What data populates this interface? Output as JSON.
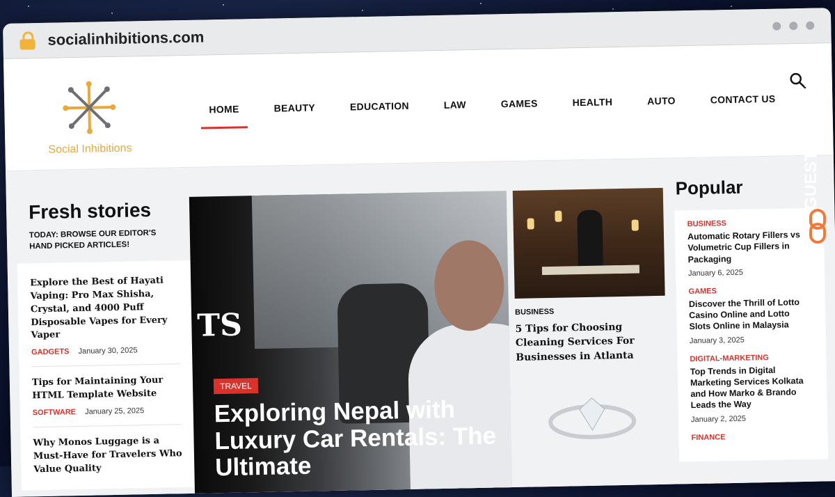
{
  "browser": {
    "url": "socialinhibitions.com"
  },
  "logo": {
    "text": "Social Inhibitions"
  },
  "nav": [
    "HOME",
    "BEAUTY",
    "EDUCATION",
    "LAW",
    "GAMES",
    "HEALTH",
    "AUTO",
    "CONTACT US"
  ],
  "fresh": {
    "title": "Fresh stories",
    "subtitle": "TODAY: BROWSE OUR EDITOR'S HAND PICKED ARTICLES!",
    "stories": [
      {
        "title": "Explore the Best of Hayati Vaping: Pro Max Shisha, Crystal, and 4000 Puff Disposable Vapes for Every Vaper",
        "category": "GADGETS",
        "date": "January 30, 2025"
      },
      {
        "title": "Tips for Maintaining Your HTML Template Website",
        "category": "SOFTWARE",
        "date": "January 25, 2025"
      },
      {
        "title": "Why Monos Luggage is a Must-Have for Travelers Who Value Quality",
        "category": "",
        "date": ""
      }
    ]
  },
  "hero": {
    "overlay_text": "TS",
    "category": "TRAVEL",
    "title": "Exploring Nepal with Luxury Car Rentals: The Ultimate"
  },
  "mid": {
    "category": "BUSINESS",
    "title": "5 Tips for Choosing Cleaning Services For Businesses in Atlanta"
  },
  "popular": {
    "title": "Popular",
    "items": [
      {
        "category": "BUSINESS",
        "title": "Automatic Rotary Fillers vs Volumetric Cup Fillers in Packaging",
        "date": "January 6, 2025"
      },
      {
        "category": "GAMES",
        "title": "Discover the Thrill of Lotto Casino Online and Lotto Slots Online in Malaysia",
        "date": "January 3, 2025"
      },
      {
        "category": "DIGITAL-MARKETING",
        "title": "Top Trends in Digital Marketing Services Kolkata and How Marko & Brando Leads the Way",
        "date": "January 2, 2025"
      },
      {
        "category": "FINANCE",
        "title": "",
        "date": ""
      }
    ]
  },
  "watermark": {
    "text": "GUESTPOSTLINKS"
  },
  "colors": {
    "accent": "#d9322c",
    "logo": "#e8a93a",
    "lock": "#f2b33c"
  }
}
